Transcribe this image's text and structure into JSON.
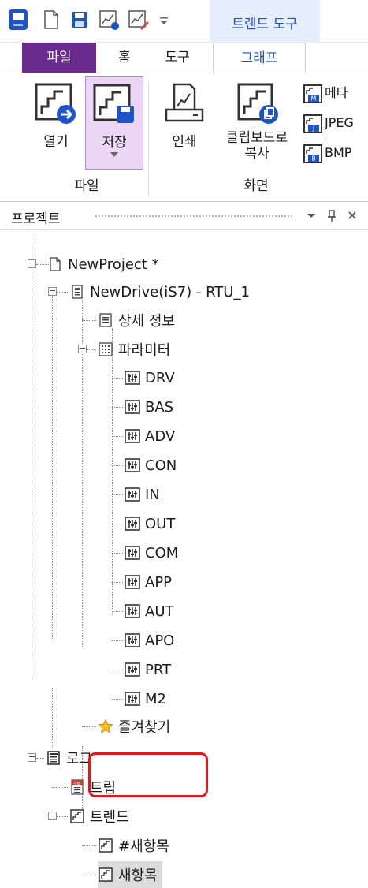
{
  "window": {
    "context_tab": "트렌드 도구"
  },
  "tabs": [
    {
      "label": "파일"
    },
    {
      "label": "홈"
    },
    {
      "label": "도구"
    },
    {
      "label": "그래프"
    }
  ],
  "ribbon": {
    "open_label": "열기",
    "save_label": "저장",
    "print_label": "인쇄",
    "clipboard_label_line1": "클립보드로",
    "clipboard_label_line2": "복사",
    "meta_label": "메타",
    "jpeg_label": "JPEG",
    "bmp_label": "BMP",
    "group_file": "파일",
    "group_screen": "화면"
  },
  "panel": {
    "title": "프로젝트"
  },
  "tree": {
    "project": "NewProject *",
    "drive": "NewDrive(iS7) - RTU_1",
    "details": "상세 정보",
    "parameters": "파라미터",
    "params": [
      "DRV",
      "BAS",
      "ADV",
      "CON",
      "IN",
      "OUT",
      "COM",
      "APP",
      "AUT",
      "APO",
      "PRT",
      "M2"
    ],
    "favorites": "즐겨찾기",
    "log": "로그",
    "trip": "트립",
    "trend": "트렌드",
    "trend_item_1": "#새항목",
    "trend_item_2": "새항목"
  },
  "colors": {
    "file_tab": "#6a2b8e",
    "accent_blue": "#1d55c9",
    "selected_ribbon": "#ecd6f5",
    "highlight": "#e0191e"
  }
}
